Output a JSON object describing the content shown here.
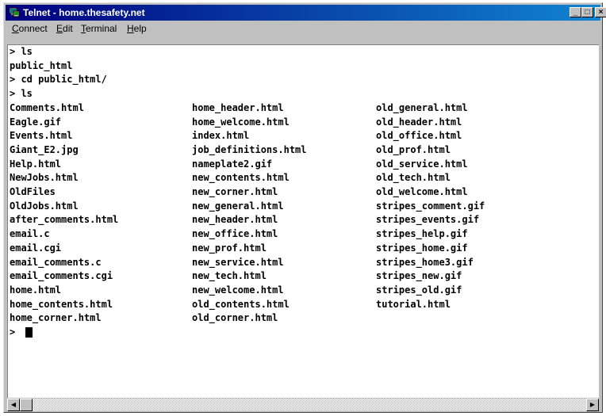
{
  "window": {
    "title": "Telnet - home.thesafety.net",
    "minimize_glyph": "_",
    "maximize_glyph": "□",
    "close_glyph": "×"
  },
  "menu": [
    {
      "mnemonic": "C",
      "rest": "onnect"
    },
    {
      "mnemonic": "E",
      "rest": "dit"
    },
    {
      "mnemonic": "T",
      "rest": "erminal"
    },
    {
      "mnemonic": "H",
      "rest": "elp"
    }
  ],
  "terminal": {
    "history": [
      "> ls",
      "public_html",
      "> cd public_html/",
      "> ls"
    ],
    "listing": {
      "col1": [
        "Comments.html",
        "Eagle.gif",
        "Events.html",
        "Giant_E2.jpg",
        "Help.html",
        "NewJobs.html",
        "OldFiles",
        "OldJobs.html",
        "after_comments.html",
        "email.c",
        "email.cgi",
        "email_comments.c",
        "email_comments.cgi",
        "home.html",
        "home_contents.html",
        "home_corner.html"
      ],
      "col2": [
        "home_header.html",
        "home_welcome.html",
        "index.html",
        "job_definitions.html",
        "nameplate2.gif",
        "new_contents.html",
        "new_corner.html",
        "new_general.html",
        "new_header.html",
        "new_office.html",
        "new_prof.html",
        "new_service.html",
        "new_tech.html",
        "new_welcome.html",
        "old_contents.html",
        "old_corner.html"
      ],
      "col3": [
        "old_general.html",
        "old_header.html",
        "old_office.html",
        "old_prof.html",
        "old_service.html",
        "old_tech.html",
        "old_welcome.html",
        "stripes_comment.gif",
        "stripes_events.gif",
        "stripes_help.gif",
        "stripes_home.gif",
        "stripes_home3.gif",
        "stripes_new.gif",
        "stripes_old.gif",
        "tutorial.html"
      ]
    },
    "prompt": "> "
  },
  "scrollbar": {
    "left_arrow": "◀",
    "right_arrow": "▶"
  }
}
